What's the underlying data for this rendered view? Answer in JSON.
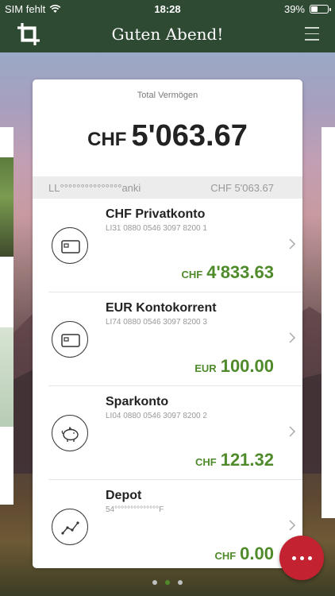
{
  "statusbar": {
    "carrier": "SIM fehlt",
    "time": "18:28",
    "battery_text": "39%",
    "battery_level": 0.39
  },
  "header": {
    "title": "Guten Abend!"
  },
  "summary": {
    "label": "Total Vermögen",
    "currency": "CHF",
    "amount": "5'063.67"
  },
  "owner": {
    "name": "LL°°°°°°°°°°°°°°°anki",
    "sum": "CHF 5'063.67"
  },
  "accounts": [
    {
      "name": "CHF Privatkonto",
      "iban": "LI31 0880 0546 3097 8200 1",
      "currency": "CHF",
      "amount": "4'833.63",
      "icon": "credit-card-icon"
    },
    {
      "name": "EUR Kontokorrent",
      "iban": "LI74 0880 0546 3097 8200 3",
      "currency": "EUR",
      "amount": "100.00",
      "icon": "credit-card-icon"
    },
    {
      "name": "Sparkonto",
      "iban": "LI04 0880 0546 3097 8200 2",
      "currency": "CHF",
      "amount": "121.32",
      "icon": "piggy-bank-icon"
    },
    {
      "name": "Depot",
      "iban": "54°°°°°°°°°°°°°°F",
      "currency": "CHF",
      "amount": "0.00",
      "icon": "line-chart-icon"
    }
  ],
  "pager": {
    "count": 3,
    "active": 2
  },
  "colors": {
    "header": "#2e4a32",
    "accent_green": "#4f8a2b",
    "fab_red": "#c32330"
  }
}
